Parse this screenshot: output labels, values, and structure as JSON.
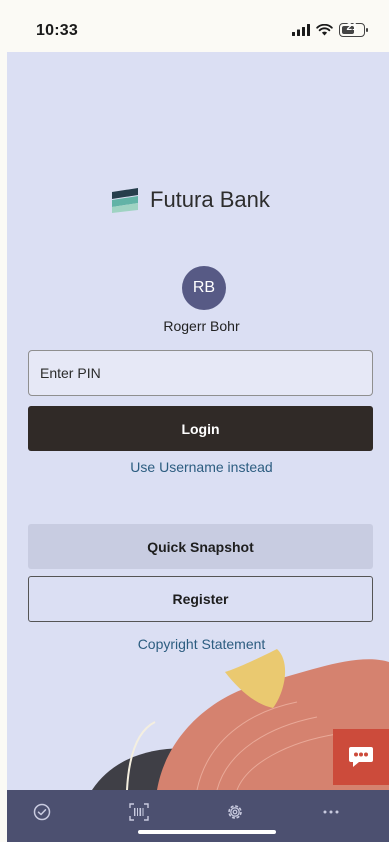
{
  "status_bar": {
    "time": "10:33",
    "battery_level": "21"
  },
  "brand": {
    "name": "Futura Bank",
    "logo_icon": "futura-bank-logo-icon",
    "colors": {
      "logo_dark": "#263e4c",
      "logo_teal": "#62b3a6",
      "logo_light": "#9fd3c2"
    }
  },
  "user": {
    "initials": "RB",
    "name": "Rogerr Bohr"
  },
  "login_form": {
    "pin_placeholder": "Enter PIN",
    "pin_value": "",
    "login_label": "Login",
    "alt_login_link": "Use Username instead"
  },
  "actions": {
    "quick_snapshot_label": "Quick Snapshot",
    "register_label": "Register",
    "copyright_link": "Copyright Statement"
  },
  "chat": {
    "icon": "chat-bubble-icon"
  },
  "bottom_nav": {
    "items": [
      {
        "icon": "check-circle-icon"
      },
      {
        "icon": "barcode-scan-icon"
      },
      {
        "icon": "settings-gear-icon"
      },
      {
        "icon": "more-dots-icon"
      }
    ]
  },
  "colors": {
    "screen_background": "#dbdff3",
    "primary_button": "#302a27",
    "secondary_button": "#c8cce1",
    "link": "#2c5d80",
    "avatar": "#575a85",
    "chat_button": "#cc4b3b",
    "nav_bar": "#4c5070"
  }
}
